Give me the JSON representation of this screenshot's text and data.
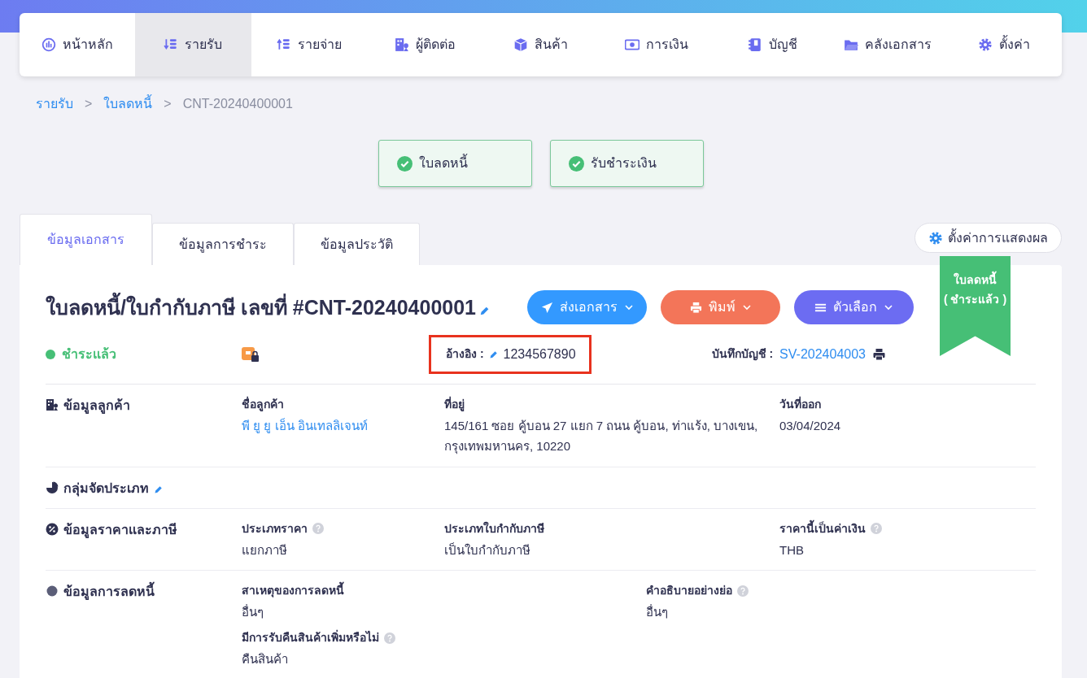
{
  "nav": [
    {
      "label": "หน้าหลัก",
      "selected": false
    },
    {
      "label": "รายรับ",
      "selected": true
    },
    {
      "label": "รายจ่าย",
      "selected": false
    },
    {
      "label": "ผู้ติดต่อ",
      "selected": false
    },
    {
      "label": "สินค้า",
      "selected": false
    },
    {
      "label": "การเงิน",
      "selected": false
    },
    {
      "label": "บัญชี",
      "selected": false
    },
    {
      "label": "คลังเอกสาร",
      "selected": false
    },
    {
      "label": "ตั้งค่า",
      "selected": false
    }
  ],
  "breadcrumb": [
    {
      "label": "รายรับ",
      "link": true
    },
    {
      "label": "ใบลดหนี้",
      "link": true
    },
    {
      "label": "CNT-20240400001",
      "link": false
    }
  ],
  "separator": ">",
  "steps": [
    {
      "label": "ใบลดหนี้",
      "done": true
    },
    {
      "label": "รับชำระเงิน",
      "done": true
    }
  ],
  "tabs": [
    {
      "label": "ข้อมูลเอกสาร",
      "selected": true
    },
    {
      "label": "ข้อมูลการชำระ",
      "selected": false
    },
    {
      "label": "ข้อมูลประวัติ",
      "selected": false
    }
  ],
  "display_settings": "ตั้งค่าการแสดงผล",
  "ribbon": {
    "title": "ใบลดหนี้",
    "subtitle": "( ชำระแล้ว )"
  },
  "document": {
    "title": "ใบลดหนี้/ใบกำกับภาษี เลขที่ #CNT-20240400001",
    "actions": [
      {
        "label": "ส่งเอกสาร",
        "kind": "send"
      },
      {
        "label": "พิมพ์",
        "kind": "print"
      },
      {
        "label": "ตัวเลือก",
        "kind": "options"
      }
    ],
    "status": "ชำระแล้ว",
    "reference": {
      "label": "อ้างอิง :",
      "value": "1234567890",
      "highlighted": true
    },
    "ledger": {
      "label": "บันทึกบัญชี :",
      "value": "SV-202404003"
    }
  },
  "sections": [
    {
      "title": "ข้อมูลลูกค้า",
      "editable": false,
      "fields": [
        {
          "label": "ชื่อลูกค้า",
          "value": "พี ยู ยู เอ็น อินเทลลิเจนท์",
          "link": true,
          "help": false
        },
        {
          "label": "ที่อยู่",
          "value": "145/161 ซอย คู้บอน 27 แยก 7 ถนน คู้บอน, ท่าแร้ง, บางเขน, กรุงเทพมหานคร, 10220",
          "link": false,
          "help": false
        },
        {
          "label": "วันที่ออก",
          "value": "03/04/2024",
          "link": false,
          "help": false
        }
      ]
    },
    {
      "title": "กลุ่มจัดประเภท",
      "editable": true
    },
    {
      "title": "ข้อมูลราคาและภาษี",
      "editable": false,
      "fields": [
        {
          "label": "ประเภทราคา",
          "value": "แยกภาษี",
          "link": false,
          "help": true
        },
        {
          "label": "ประเภทใบกำกับภาษี",
          "value": "เป็นใบกำกับภาษี",
          "link": false,
          "help": false
        },
        {
          "label": "ราคานี้เป็นค่าเงิน",
          "value": "THB",
          "link": false,
          "help": true
        }
      ]
    },
    {
      "title": "ข้อมูลการลดหนี้",
      "editable": false,
      "fields": [
        {
          "label": "สาเหตุของการลดหนี้",
          "value": "อื่นๆ",
          "link": false,
          "help": false
        },
        {
          "label": "คำอธิบายอย่างย่อ",
          "value": "อื่นๆ",
          "link": false,
          "help": true
        },
        {
          "label": "มีการรับคืนสินค้าเพิ่มหรือไม่",
          "value": "คืนสินค้า",
          "link": false,
          "help": true
        }
      ]
    }
  ]
}
